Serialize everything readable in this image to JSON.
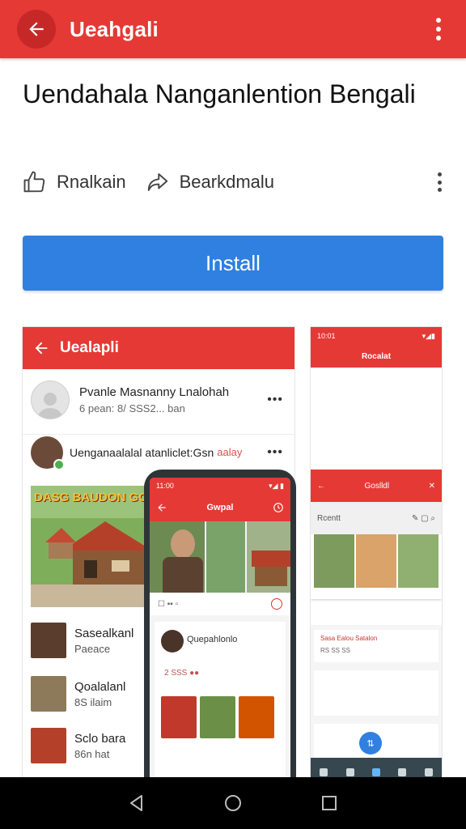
{
  "appbar": {
    "title": "Ueahgali"
  },
  "heading": {
    "title": "Uendahala Nanganlention Bengali"
  },
  "actions": {
    "like_label": "Rnalkain",
    "share_label": "Bearkdmalu"
  },
  "install": {
    "label": "Install"
  },
  "screenshot1": {
    "title": "Uealapli",
    "post1": {
      "name": "Pvanle Masnanny Lnalohah",
      "sub": "6 pean: 8/ SSS2... ban"
    },
    "post2": {
      "text": "Uenganaalalal atanliclet:Gsn",
      "tag": "aalay"
    },
    "banner_text": "DASG BAUDON GOG",
    "items": [
      {
        "title": "Sasealkanl",
        "sub": "Paeace"
      },
      {
        "title": "Qoalalanl",
        "sub": "8S ilaim"
      },
      {
        "title": "Sclo bara",
        "sub": "86n hat"
      }
    ]
  },
  "phone": {
    "status_time": "11:00",
    "status_icons": "▾◢ ▮",
    "title": "Gwpal",
    "card_name": "Quepahlonlo",
    "card_sub": "2 SSS ●●"
  },
  "screenshot2": {
    "status_time": "10:01",
    "title": "Rocalat",
    "panel_title": "Goslldl",
    "tools_label": "Rcentt",
    "meta_line1": "Sasa Ealou Satalon",
    "meta_line2": "RS SS SS",
    "fab_label": "⇅"
  },
  "colors": {
    "brand_red": "#e53935",
    "install_blue": "#2f80e0"
  }
}
